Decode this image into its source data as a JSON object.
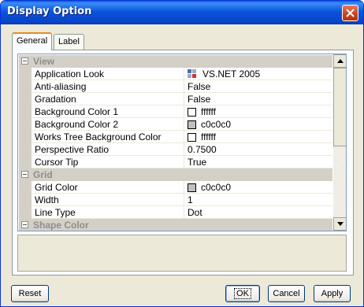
{
  "window": {
    "title": "Display Option"
  },
  "tabs": [
    {
      "label": "General",
      "active": true
    },
    {
      "label": "Label",
      "active": false
    }
  ],
  "grid": {
    "categories": [
      {
        "label": "View",
        "properties": [
          {
            "name": "Application Look",
            "value": "VS.NET 2005",
            "icon": "app-look-icon"
          },
          {
            "name": "Anti-aliasing",
            "value": "False"
          },
          {
            "name": "Gradation",
            "value": "False"
          },
          {
            "name": "Background Color 1",
            "value": "ffffff",
            "swatch": "#ffffff"
          },
          {
            "name": "Background Color 2",
            "value": "c0c0c0",
            "swatch": "#c0c0c0"
          },
          {
            "name": "Works Tree Background Color",
            "value": "ffffff",
            "swatch": "#ffffff"
          },
          {
            "name": "Perspective Ratio",
            "value": "0.7500"
          },
          {
            "name": "Cursor Tip",
            "value": "True"
          }
        ]
      },
      {
        "label": "Grid",
        "properties": [
          {
            "name": "Grid Color",
            "value": "c0c0c0",
            "swatch": "#c0c0c0"
          },
          {
            "name": "Width",
            "value": "1"
          },
          {
            "name": "Line Type",
            "value": "Dot"
          }
        ]
      },
      {
        "label": "Shape Color",
        "properties": []
      }
    ]
  },
  "buttons": {
    "reset": "Reset",
    "ok": "OK",
    "cancel": "Cancel",
    "apply": "Apply"
  },
  "colors": {
    "titlebar": "#0a55df",
    "dialog_bg": "#ece9d8",
    "category_bg": "#d4d0c8",
    "category_text": "#8e8e8e"
  }
}
